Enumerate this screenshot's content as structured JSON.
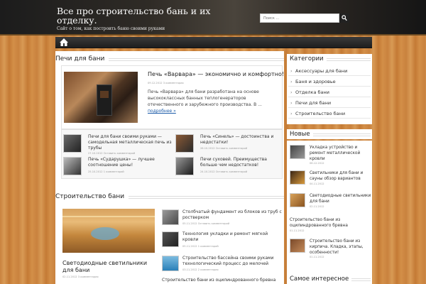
{
  "header": {
    "title": "Все про строительство бань и их отделку.",
    "description": "Сайт о том, как построить баню своими руками",
    "search_placeholder": "Поиск ..."
  },
  "colors": {
    "wood": "#c9823e",
    "header": "#1c1c1c",
    "link": "#1a5aa8"
  },
  "sections": {
    "stoves": {
      "title": "Печи для бани",
      "featured": {
        "title": "Печь «Варвара» — экономично и комфортно!",
        "meta": "09.12.2012 3 комментария",
        "text": "Печь «Варвара» для бани разработана на основе высококлассных банных теплогенераторов отечественного и зарубежного производства. В ...",
        "more": "подробнее »"
      },
      "items": [
        {
          "title": "Печи для бани своими руками — самодельная металлическая печь из трубы",
          "meta": "27.10.2012 Оставить комментарий"
        },
        {
          "title": "Печь «Синель» — достоинства и недостатки!",
          "meta": "26.10.2012 Оставить комментарий"
        },
        {
          "title": "Печь «Сударушка» — лучшее соотношение цены!",
          "meta": "25.10.2012 1 комментарий"
        },
        {
          "title": "Печи суховей. Преимущества больше чем недостатков!",
          "meta": "24.10.2012 Оставить комментарий"
        }
      ]
    },
    "bath": {
      "title": "Строительство бани",
      "featured": {
        "title": "Светодиодные светильники для бани",
        "meta": "02.11.2012 3 комментария"
      },
      "items": [
        {
          "title": "Столбчатый фундамент из блоков из труб с ростверком",
          "meta": "05.11.2012 Оставить комментарий"
        },
        {
          "title": "Технология укладки и ремонт мягкой кровли",
          "meta": "05.11.2012 1 комментарий"
        },
        {
          "title": "Строительство бассейна своими руками технологический процесс до мелочей",
          "meta": "03.11.2012 2 комментария"
        }
      ],
      "bottom_link": "Строительство бани из оцилиндрованного бревна"
    }
  },
  "sidebar": {
    "categories_title": "Категории",
    "categories": [
      "Аксессуары для бани",
      "Баня и здоровье",
      "Отделка бани",
      "Печи для бани",
      "Строительство бани"
    ],
    "new_title": "Новые",
    "new_items": [
      {
        "title": "Укладка устройство и ремонт металлической кровли",
        "meta": "06.12.2012"
      },
      {
        "title": "Светильники для бани и сауны обзор вариантов",
        "meta": "04.11.2012"
      },
      {
        "title": "Светодиодные светильники для бани",
        "meta": "02.11.2012"
      },
      {
        "title": "Строительство бани из оцилиндрованного бревна",
        "meta": "01.11.2012"
      },
      {
        "title": "Строительство бани из кирпича. Кладка, этапы, особенности!",
        "meta": "01.11.2012"
      }
    ],
    "popular_title": "Самое интересное"
  }
}
